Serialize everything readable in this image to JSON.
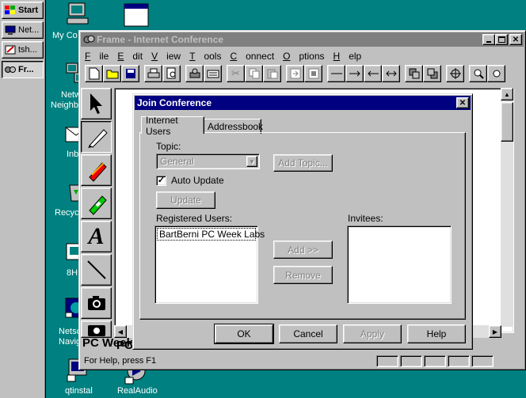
{
  "taskbar": {
    "items": [
      {
        "label": "Start"
      },
      {
        "label": "Net..."
      },
      {
        "label": "tsh..."
      },
      {
        "label": "Fr..."
      }
    ]
  },
  "desktop": {
    "icons": [
      {
        "label": "My Co"
      },
      {
        "label": "Netw"
      },
      {
        "label": "Neighb"
      },
      {
        "label": "Inb"
      },
      {
        "label": "Recyc"
      },
      {
        "label": "8H"
      },
      {
        "label": "Netsc"
      },
      {
        "label": "Navig"
      },
      {
        "label": "qtinstal"
      },
      {
        "label": "RealAudio"
      }
    ]
  },
  "window": {
    "title": "Frame - Internet Conference",
    "menu": [
      "File",
      "Edit",
      "View",
      "Tools",
      "Connect",
      "Options",
      "Help"
    ],
    "canvas_text": "PC Week",
    "status": "For Help, press F1"
  },
  "dialog": {
    "title": "Join Conference",
    "tabs": [
      "Internet Users",
      "Addressbook"
    ],
    "topic_label": "Topic:",
    "topic_value": "General",
    "add_topic": "Add Topic...",
    "auto_update": "Auto Update",
    "update": "Update",
    "registered_label": "Registered Users:",
    "registered_users": [
      "BartBerni PC Week Labs"
    ],
    "invitees_label": "Invitees:",
    "add": "Add >>",
    "remove": "Remove",
    "ok": "OK",
    "cancel": "Cancel",
    "apply": "Apply",
    "help": "Help"
  }
}
